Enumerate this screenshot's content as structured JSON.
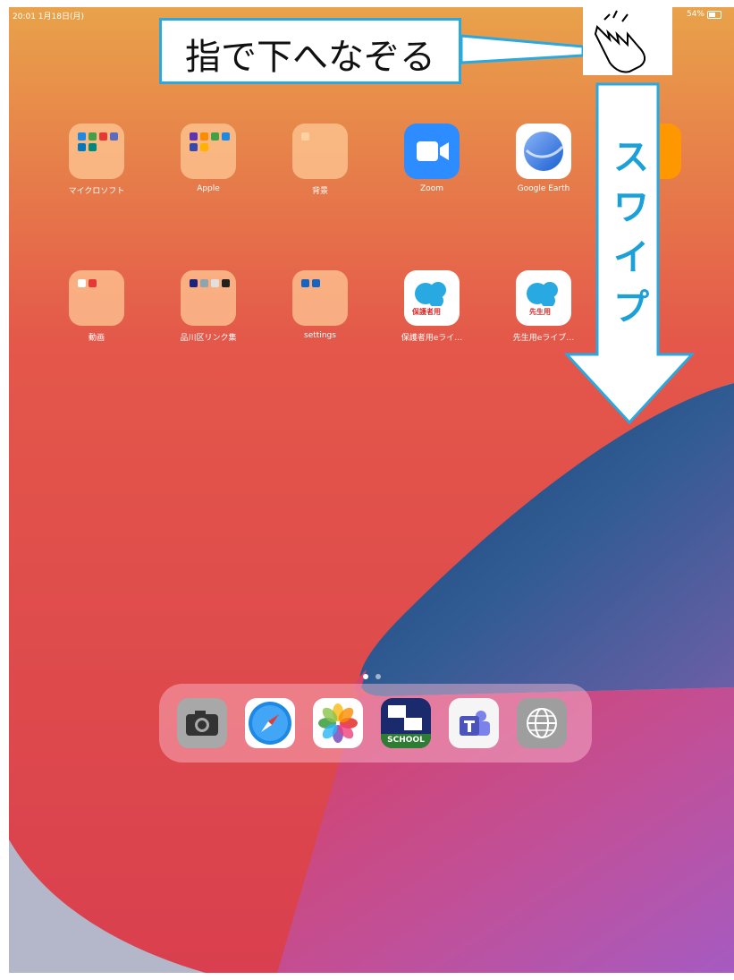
{
  "status_bar": {
    "time_date": "20:01 1月18日(月)",
    "battery": "54%"
  },
  "apps_row1": [
    {
      "label": "マイクロソフト",
      "icon": "folder-microsoft"
    },
    {
      "label": "Apple",
      "icon": "folder-apple"
    },
    {
      "label": "背景",
      "icon": "folder-background"
    },
    {
      "label": "Zoom",
      "icon": "zoom-icon"
    },
    {
      "label": "Google Earth",
      "icon": "google-earth-icon"
    }
  ],
  "apps_row2": [
    {
      "label": "動画",
      "icon": "folder-video"
    },
    {
      "label": "品川区リンク集",
      "icon": "folder-links"
    },
    {
      "label": "settings",
      "icon": "folder-settings"
    },
    {
      "label": "保護者用eライ…",
      "icon": "live-guardian-icon",
      "badge": "保護者用"
    },
    {
      "label": "先生用eライブ…",
      "icon": "live-teacher-icon",
      "badge": "先生用"
    }
  ],
  "page_indicator": {
    "pages": 2,
    "current": 1
  },
  "dock": [
    "camera-icon",
    "safari-icon",
    "photos-icon",
    "school-app-icon",
    "teams-icon",
    "globe-icon"
  ],
  "dock_school_label": "SCHOOL",
  "annotation": {
    "callout": "指で下へなぞる",
    "swipe": "スワイプ",
    "hand": "pointing-hand-icon"
  },
  "colors": {
    "callout_border": "#2aa9e0",
    "swipe_text": "#1ca0d8"
  }
}
